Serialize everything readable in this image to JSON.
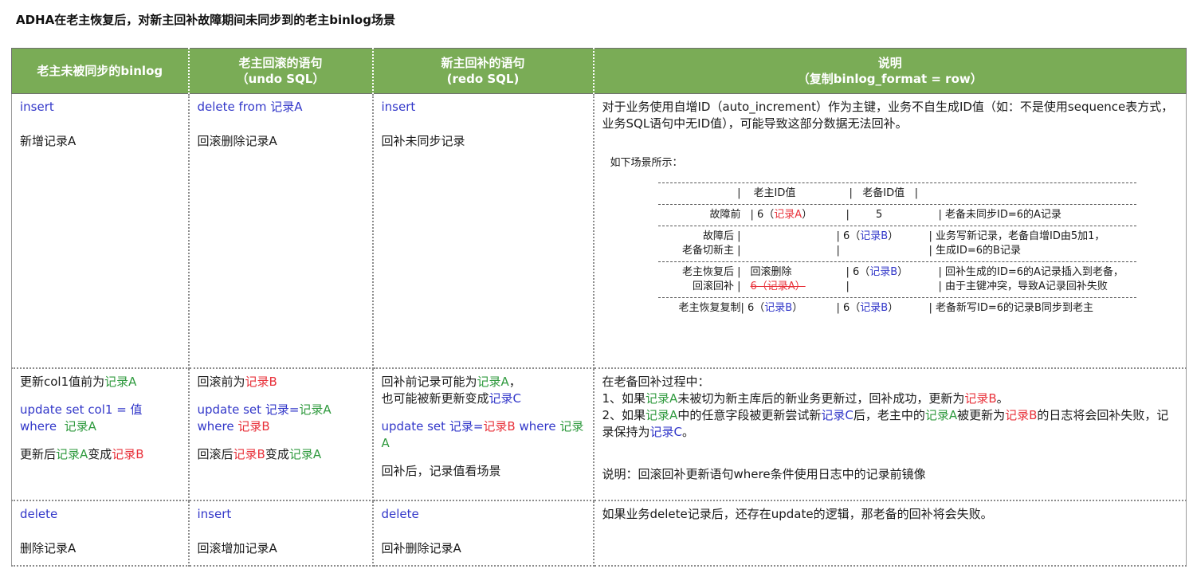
{
  "title": "ADHA在老主恢复后，对新主回补故障期间未同步到的老主binlog场景",
  "headers": {
    "col1": "老主未被同步的binlog",
    "col2_l1": "老主回滚的语句",
    "col2_l2": "（undo SQL）",
    "col3_l1": "新主回补的语句",
    "col3_l2": "(redo SQL)",
    "col4_l1": "说明",
    "col4_l2": "（复制binlog_format = row）"
  },
  "row1": {
    "c1_sql": "insert",
    "c1_desc": "新增记录A",
    "c2_sql_a": "delete from",
    "c2_sql_b": "记录A",
    "c2_desc": "回滚删除记录A",
    "c3_sql": "insert",
    "c3_desc": "回补未同步记录",
    "c4_text": "对于业务使用自增ID（auto_increment）作为主键，业务不自生成ID值（如：不是使用sequence表方式，业务SQL语句中无ID值），可能导致这部分数据无法回补。",
    "ex_intro": "如下场景所示：",
    "ex": {
      "h_sep1": "|",
      "h_old_id": "老主ID值",
      "h_sep2": "|",
      "h_backup_id": "老备ID值",
      "h_sep3": "|",
      "r1_label": "故障前",
      "r1_v1a": "| 6（",
      "r1_v1b": "记录A",
      "r1_v1c": "）",
      "r1_v2": "|        5",
      "r1_note": "| 老备未同步ID=6的A记录",
      "r2_label_a": "故障后 |",
      "r2_label_b": "老备切新主 |",
      "r2_v2a": "|  6（",
      "r2_v2b": "记录B",
      "r2_v2c": "）",
      "r2_v2_l2": "|",
      "r2_note_a": "| 业务写新记录，老备自增ID由5加1，",
      "r2_note_b": "|  生成ID=6的B记录",
      "r3_label_a": "老主恢复后 |",
      "r3_label_b": "回滚回补 |",
      "r3_v1a": "回滚删除",
      "r3_v1b": "6（记录A）",
      "r3_v2a": "|  6（",
      "r3_v2b": "记录B",
      "r3_v2c": "）",
      "r3_v2_l2": "|",
      "r3_note_a": "| 回补生成的ID=6的A记录插入到老备，",
      "r3_note_b": "| 由于主键冲突，导致A记录回补失败",
      "r4_label": "老主恢复复制",
      "r4_v1a": "| 6（",
      "r4_v1b": "记录B",
      "r4_v1c": "）",
      "r4_v2a": "|  6（",
      "r4_v2b": "记录B",
      "r4_v2c": "）",
      "r4_note": "| 老备新写ID=6的记录B同步到老主"
    }
  },
  "row2": {
    "c1_l1a": "更新col1值前为",
    "c1_l1b": "记录A",
    "c1_sql_l1": "update  set col1 = 值",
    "c1_sql_l2a": "where",
    "c1_sql_l2b": "记录A",
    "c1_l3a": "更新后",
    "c1_l3b": "记录A",
    "c1_l3c": "变成",
    "c1_l3d": "记录B",
    "c2_l1a": "回滚前为",
    "c2_l1b": "记录B",
    "c2_sql_l1a": "update  set",
    "c2_sql_l1b": "记录=",
    "c2_sql_l1c": "记录A",
    "c2_sql_l2a": "where",
    "c2_sql_l2b": "记录B",
    "c2_l3a": "回滚后",
    "c2_l3b": "记录B",
    "c2_l3c": "变成",
    "c2_l3d": "记录A",
    "c3_l1a": "回补前记录可能为",
    "c3_l1b": "记录A",
    "c3_l1c": "，",
    "c3_l2a": "也可能被新更新变成",
    "c3_l2b": "记录C",
    "c3_sql_a": "update set",
    "c3_sql_b": "记录=",
    "c3_sql_c": "记录B",
    "c3_sql_d": "where",
    "c3_sql_e": "记录A",
    "c3_l4": "回补后，记录值看场景",
    "c4_l1": "在老备回补过程中：",
    "c4_l2a": "1、如果",
    "c4_l2b": "记录A",
    "c4_l2c": "未被切为新主库后的新业务更新过，回补成功，更新为",
    "c4_l2d": "记录B",
    "c4_l2e": "。",
    "c4_l3a": "2、如果",
    "c4_l3b": "记录A",
    "c4_l3c": "中的任意字段被更新尝试新",
    "c4_l3d": "记录C",
    "c4_l3e": "后，老主中的",
    "c4_l3f": "记录A",
    "c4_l3g": "被更新为",
    "c4_l3h": "记录B",
    "c4_l3i": "的日志将会回补失败，记录保持为",
    "c4_l3j": "记录C",
    "c4_l3k": "。",
    "c4_note": "说明：回滚回补更新语句where条件使用日志中的记录前镜像"
  },
  "row3": {
    "c1_sql": "delete",
    "c1_desc": "删除记录A",
    "c2_sql": "insert",
    "c2_desc": "回滚增加记录A",
    "c3_sql": "delete",
    "c3_desc": "回补删除记录A",
    "c4_text": "如果业务delete记录后，还存在update的逻辑，那老备的回补将会失败。"
  },
  "colors": {
    "header_bg": "#7aac56",
    "blue": "#3237c9",
    "green": "#2f9a3e",
    "red": "#e8313a"
  }
}
